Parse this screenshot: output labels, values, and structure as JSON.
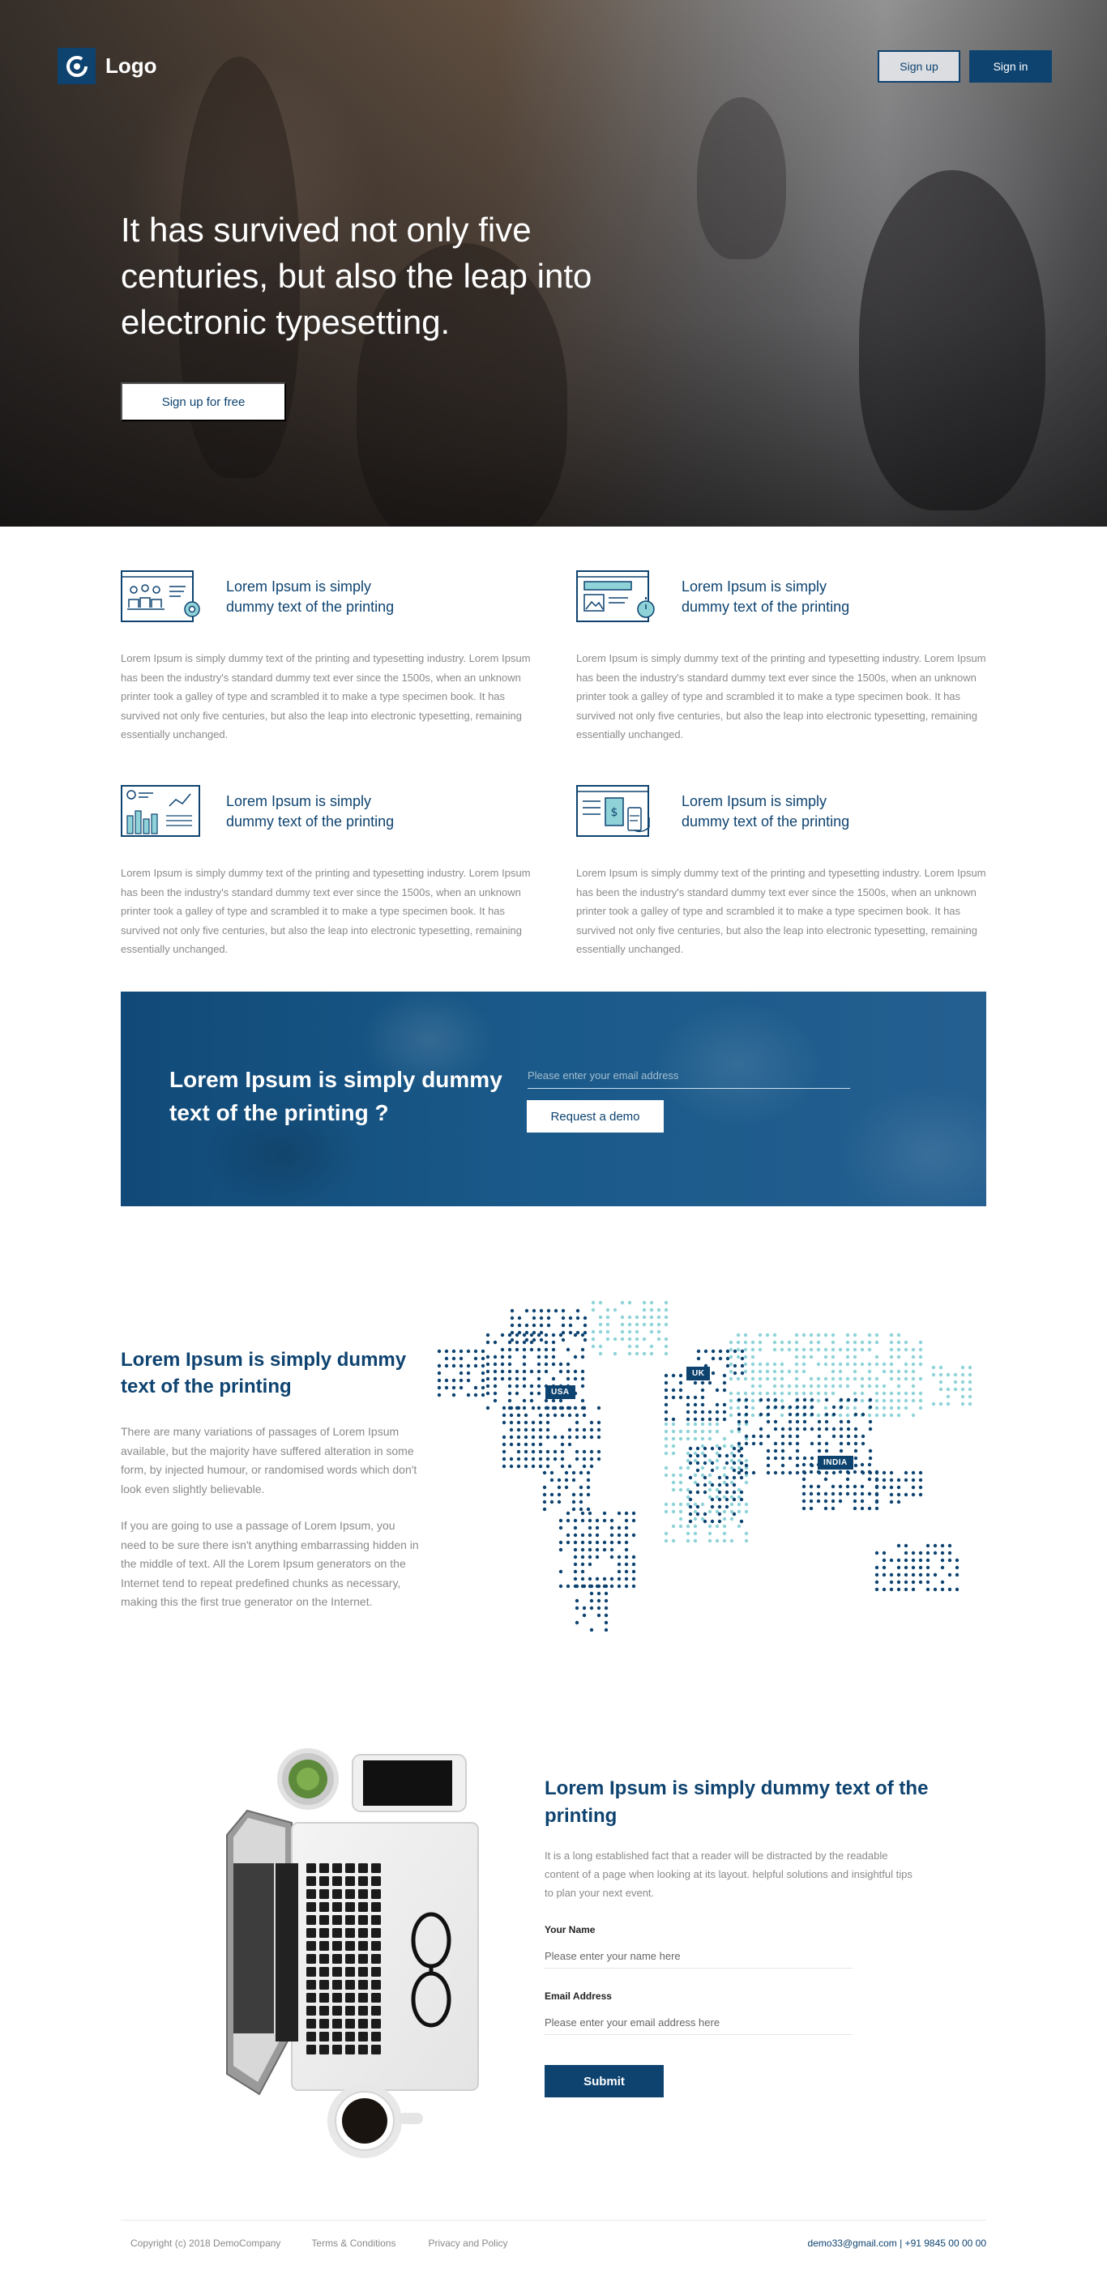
{
  "header": {
    "logo_text": "Logo",
    "signup_label": "Sign up",
    "signin_label": "Sign in"
  },
  "hero": {
    "title": "It has survived not only five centuries, but also the leap into electronic typesetting.",
    "cta_label": "Sign up for free"
  },
  "features": [
    {
      "icon": "team-presentation-icon",
      "title": "Lorem Ipsum is simply dummy text of the printing",
      "body": "Lorem Ipsum is simply dummy text of the printing and typesetting industry. Lorem Ipsum has been the industry's standard dummy text ever since the 1500s, when an unknown printer took a galley of type and scrambled it to make a type specimen book. It has survived not only five centuries, but also the leap into electronic typesetting, remaining essentially unchanged."
    },
    {
      "icon": "screen-stopwatch-icon",
      "title": "Lorem Ipsum is simply dummy text of the printing",
      "body": "Lorem Ipsum is simply dummy text of the printing and typesetting industry. Lorem Ipsum has been the industry's standard dummy text ever since the 1500s, when an unknown printer took a galley of type and scrambled it to make a type specimen book. It has survived not only five centuries, but also the leap into electronic typesetting, remaining essentially unchanged."
    },
    {
      "icon": "analytics-chart-icon",
      "title": "Lorem Ipsum is simply dummy text of the printing",
      "body": "Lorem Ipsum is simply dummy text of the printing and typesetting industry. Lorem Ipsum has been the industry's standard dummy text ever since the 1500s, when an unknown printer took a galley of type and scrambled it to make a type specimen book. It has survived not only five centuries, but also the leap into electronic typesetting, remaining essentially unchanged."
    },
    {
      "icon": "payment-card-icon",
      "title": "Lorem Ipsum is simply dummy text of the printing",
      "body": "Lorem Ipsum is simply dummy text of the printing and typesetting industry. Lorem Ipsum has been the industry's standard dummy text ever since the 1500s, when an unknown printer took a galley of type and scrambled it to make a type specimen book. It has survived not only five centuries, but also the leap into electronic typesetting, remaining essentially unchanged."
    }
  ],
  "demo": {
    "title": "Lorem Ipsum is simply dummy text of the printing ?",
    "email_placeholder": "Please enter your email address",
    "button_label": "Request a demo"
  },
  "map_section": {
    "title": "Lorem Ipsum is simply dummy text of the printing",
    "paragraph_1": "There are many variations of passages of Lorem Ipsum available, but the majority have suffered alteration in some form, by injected humour, or randomised words which don't look even slightly believable.",
    "paragraph_2": "If you are going to use a passage of Lorem Ipsum, you need to be sure there isn't anything embarrassing hidden in the middle of text. All the Lorem Ipsum generators on the Internet tend to repeat predefined chunks as necessary, making this the first true generator on the Internet.",
    "labels": {
      "usa": "USA",
      "uk": "UK",
      "india": "INDIA"
    }
  },
  "contact": {
    "title": "Lorem Ipsum is simply dummy text of the printing",
    "description": "It is a long established fact that a reader will be distracted by the readable content of a page when looking at its layout. helpful solutions and insightful tips to plan your next event.",
    "name_label": "Your Name",
    "name_placeholder": "Please enter your name here",
    "email_label": "Email Address",
    "email_placeholder": "Please enter your email address here",
    "submit_label": "Submit"
  },
  "footer": {
    "copyright": "Copyright (c) 2018 DemoCompany",
    "terms": "Terms & Conditions",
    "privacy": "Privacy and Policy",
    "contact_info": "demo33@gmail.com | +91 9845 00 00 00"
  },
  "colors": {
    "brand": "#0e4370",
    "accent_light": "#8fd3d8"
  }
}
